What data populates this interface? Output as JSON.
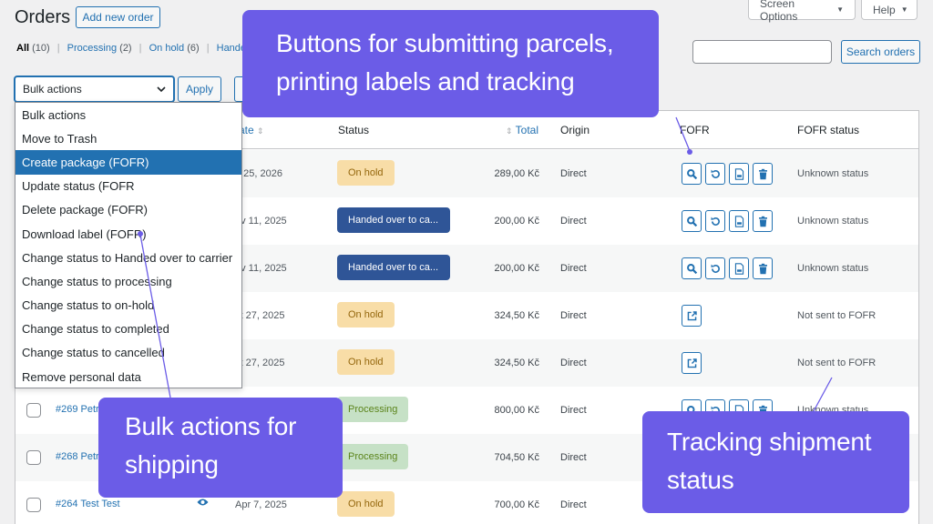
{
  "header": {
    "title": "Orders",
    "add_new": "Add new order",
    "screen_options": "Screen Options",
    "help": "Help"
  },
  "filters": {
    "all": "All",
    "all_count": "(10)",
    "processing": "Processing",
    "processing_count": "(2)",
    "on_hold": "On hold",
    "on_hold_count": "(6)",
    "handed": "Handed o"
  },
  "search": {
    "button": "Search orders"
  },
  "bulk": {
    "selected": "Bulk actions",
    "apply": "Apply",
    "options": [
      "Bulk actions",
      "Move to Trash",
      "Create package (FOFR)",
      "Update status (FOFR",
      "Delete package (FOFR)",
      "Download label (FOFR)",
      "Change status to Handed over to carrier",
      "Change status to processing",
      "Change status to on-hold",
      "Change status to completed",
      "Change status to cancelled",
      "Remove personal data"
    ],
    "highlighted": "Create package (FOFR)"
  },
  "columns": {
    "date": "ate",
    "status": "Status",
    "total": "Total",
    "origin": "Origin",
    "fofr": "FOFR",
    "fofr_status": "FOFR status"
  },
  "rows": [
    {
      "order": "",
      "date": "n 25, 2026",
      "status": "On hold",
      "total": "289,00 Kč",
      "origin": "Direct",
      "fofr_status": "Unknown status"
    },
    {
      "order": "",
      "date": "ov 11, 2025",
      "status": "Handed over to ca...",
      "total": "200,00 Kč",
      "origin": "Direct",
      "fofr_status": "Unknown status"
    },
    {
      "order": "",
      "date": "ov 11, 2025",
      "status": "Handed over to ca...",
      "total": "200,00 Kč",
      "origin": "Direct",
      "fofr_status": "Unknown status"
    },
    {
      "order": "",
      "date": "ct 27, 2025",
      "status": "On hold",
      "total": "324,50 Kč",
      "origin": "Direct",
      "fofr_status": "Not sent to FOFR"
    },
    {
      "order": "",
      "date": "ct 27, 2025",
      "status": "On hold",
      "total": "324,50 Kč",
      "origin": "Direct",
      "fofr_status": "Not sent to FOFR"
    },
    {
      "order": "#269 Petr",
      "date": "",
      "status": "Processing",
      "total": "800,00 Kč",
      "origin": "Direct",
      "fofr_status": "Unknown status"
    },
    {
      "order": "#268 Petr",
      "date": "",
      "status": "Processing",
      "total": "704,50 Kč",
      "origin": "Direct",
      "fofr_status": ""
    },
    {
      "order": "#264 Test Test",
      "date": "Apr 7, 2025",
      "status": "On hold",
      "total": "700,00 Kč",
      "origin": "Direct",
      "fofr_status": ""
    }
  ],
  "callouts": {
    "top_line1": "Buttons for submitting parcels,",
    "top_line2": "printing labels and tracking",
    "bulk_line1": "Bulk actions for",
    "bulk_line2": "shipping",
    "track_line1": "Tracking shipment",
    "track_line2": "status"
  },
  "colors": {
    "accent": "#2271b1",
    "callout": "#6b5ce7",
    "on_hold_bg": "#f8dda7",
    "on_hold_fg": "#94660c",
    "processing_bg": "#c6e1c6",
    "processing_fg": "#5b841b",
    "handed_bg": "#2f5597",
    "handed_fg": "#ffffff"
  }
}
